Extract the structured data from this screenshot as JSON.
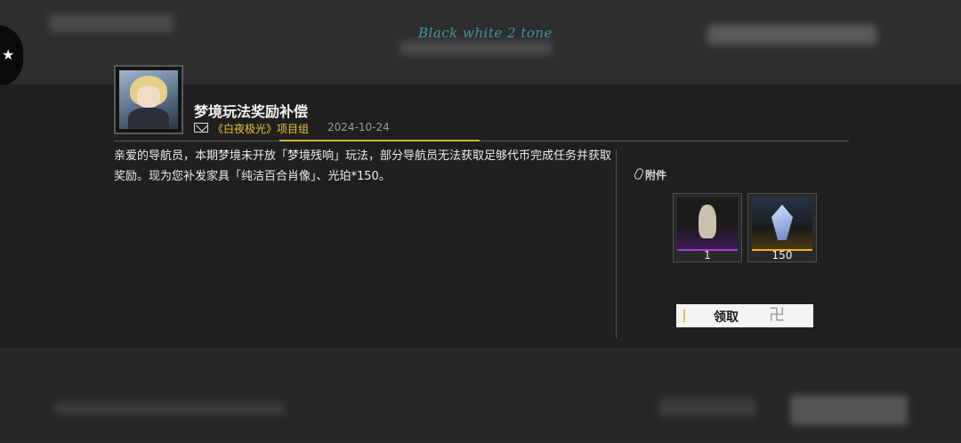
{
  "watermark": "Black white 2 tone",
  "mail": {
    "title": "梦境玩法奖励补偿",
    "sender": "《白夜极光》项目组",
    "date": "2024-10-24",
    "body": "亲爱的导航员，本期梦境未开放「梦境残响」玩法，部分导航员无法获取足够代币完成任务并获取奖励。现为您补发家具「纯洁百合肖像」、光珀*150。"
  },
  "attachments": {
    "label": "附件",
    "items": [
      {
        "qty": "1",
        "rarity_color": "#9b3fd6"
      },
      {
        "qty": "150",
        "rarity_color": "#e8b424"
      }
    ]
  },
  "claim_button": {
    "label": "领取"
  },
  "icons": [
    "mail-icon",
    "paperclip-icon",
    "character-avatar",
    "furniture-item-icon",
    "currency-item-icon"
  ],
  "colors": {
    "accent": "#e8c33a",
    "panel": "#1f1f1f"
  }
}
